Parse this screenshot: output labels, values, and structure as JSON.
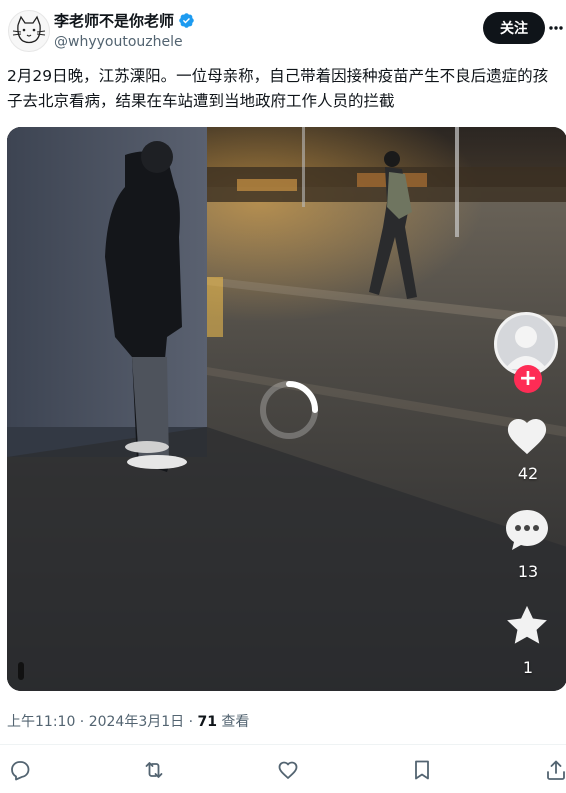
{
  "author": {
    "display_name": "李老师不是你老师",
    "handle": "@whyyoutouzhele"
  },
  "follow_button": {
    "label": "关注"
  },
  "tweet": {
    "text": "2月29日晚，江苏溧阳。一位母亲称，自己带着因接种疫苗产生不良后遗症的孩子去北京看病，结果在车站遭到当地政府工作人员的拦截"
  },
  "video": {
    "likes": "42",
    "comments": "13",
    "favorites": "1",
    "plus_color": "#fe2c55"
  },
  "meta": {
    "time_date": "上午11:10 · 2024年3月1日 · ",
    "views_count": "71",
    "views_label": " 查看"
  },
  "colors": {
    "accent": "#1d9bf0",
    "text": "#0f1419",
    "muted": "#536471"
  }
}
